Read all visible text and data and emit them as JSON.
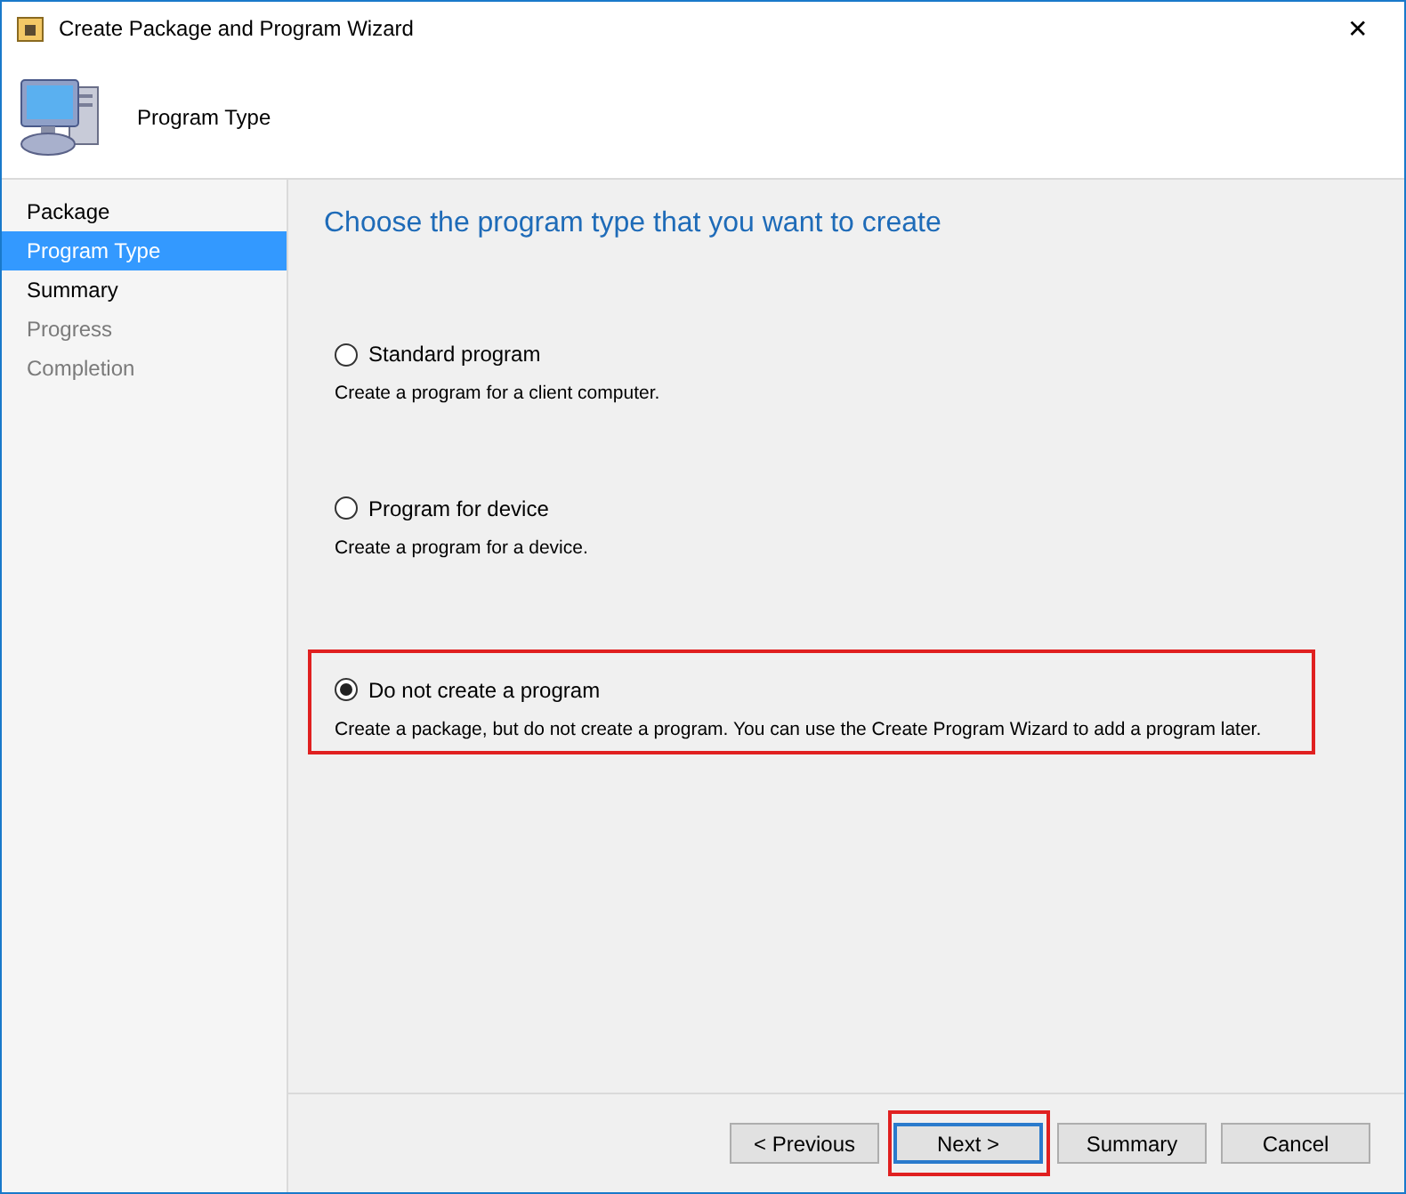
{
  "window": {
    "title": "Create Package and Program Wizard",
    "close": "✕"
  },
  "header": {
    "title": "Program Type"
  },
  "sidebar": {
    "items": [
      {
        "label": "Package",
        "selected": false,
        "disabled": false
      },
      {
        "label": "Program Type",
        "selected": true,
        "disabled": false
      },
      {
        "label": "Summary",
        "selected": false,
        "disabled": false
      },
      {
        "label": "Progress",
        "selected": false,
        "disabled": true
      },
      {
        "label": "Completion",
        "selected": false,
        "disabled": true
      }
    ]
  },
  "content": {
    "heading": "Choose the program type that you want to create",
    "options": [
      {
        "label": "Standard program",
        "description": "Create a program for a client computer.",
        "selected": false,
        "highlighted": false
      },
      {
        "label": "Program for device",
        "description": "Create a program for a device.",
        "selected": false,
        "highlighted": false
      },
      {
        "label": "Do not create a program",
        "description": "Create a package, but do not create a program. You can use the Create Program Wizard to add a program later.",
        "selected": true,
        "highlighted": true
      }
    ]
  },
  "buttons": [
    {
      "label": "< Previous",
      "default": false,
      "highlighted": false
    },
    {
      "label": "Next >",
      "default": true,
      "highlighted": true
    },
    {
      "label": "Summary",
      "default": false,
      "highlighted": false
    },
    {
      "label": "Cancel",
      "default": false,
      "highlighted": false
    }
  ]
}
